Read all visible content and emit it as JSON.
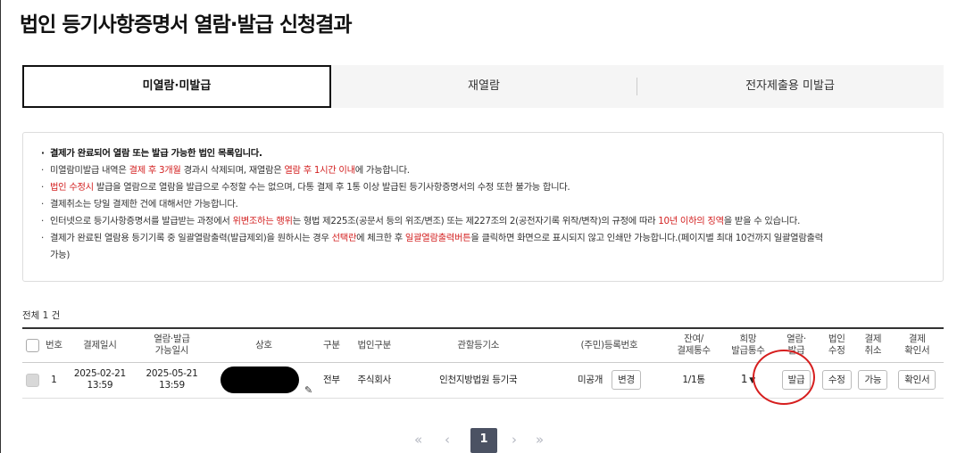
{
  "page_title": "법인 등기사항증명서 열람·발급 신청결과",
  "tabs": [
    {
      "label": "미열람·미발급",
      "active": true
    },
    {
      "label": "재열람",
      "active": false
    },
    {
      "label": "전자제출용 미발급",
      "active": false
    }
  ],
  "notice": {
    "line1": "결제가 완료되어 열람 또는 발급 가능한 법인 목록입니다.",
    "line2": {
      "a": "미열람미발급 내역은 ",
      "b": "결제 후 3개월",
      "c": " 경과시 삭제되며, 재열람은 ",
      "d": "열람 후 1시간 이내",
      "e": "에 가능합니다."
    },
    "line3": {
      "a": "법인 수정시",
      "b": " 발급을 열람으로 열람을 발급으로 수정할 수는 없으며, 다통 결제 후 1통 이상 발급된 등기사항증명서의 수정 또한 불가능 합니다."
    },
    "line4": "결제취소는 당일 결제한 건에 대해서만 가능합니다.",
    "line5": {
      "a": "인터넷으로 등기사항증명서를 발급받는 과정에서 ",
      "b": "위변조하는 행위",
      "c": "는 형법 제225조(공문서 등의 위조/변조) 또는 제227조의 2(공전자기록 위작/변작)의 규정에 따라 ",
      "d": "10년 이하의 징역",
      "e": "을 받을 수 있습니다."
    },
    "line6": {
      "a": "결제가 완료된 열람용 등기기록 중 일괄열람출력(발급제외)을 원하시는 경우 ",
      "b": "선택란",
      "c": "에 체크한 후 ",
      "d": "일괄열람출력버튼",
      "e": "을 클릭하면 화면으로 표시되지 않고 인쇄만 가능합니다.(페이지별 최대 10건까지 일괄열람출력",
      "f": "가능)"
    }
  },
  "count_label": "전체 1 건",
  "table": {
    "headers": {
      "no": "번호",
      "paid_date": "결제일시",
      "avail_date_1": "열람·발급",
      "avail_date_2": "가능일시",
      "company": "상호",
      "type": "구분",
      "corp_type": "법인구분",
      "registry": "관할등기소",
      "reg_no": "(주민)등록번호",
      "remain_1": "잔여/",
      "remain_2": "결제통수",
      "hope_1": "희망",
      "hope_2": "발급통수",
      "issue_1": "열람·",
      "issue_2": "발급",
      "edit_1": "법인",
      "edit_2": "수정",
      "cancel_1": "결제",
      "cancel_2": "취소",
      "receipt_1": "결제",
      "receipt_2": "확인서"
    },
    "rows": [
      {
        "no": "1",
        "paid_date": "2025-02-21",
        "paid_time": "13:59",
        "avail_date": "2025-05-21",
        "avail_time": "13:59",
        "type": "전부",
        "corp_type": "주식회사",
        "registry": "인천지방법원 등기국",
        "reg_no": "미공개",
        "change_btn": "변경",
        "remain": "1/1통",
        "hope_count": "1",
        "issue_btn": "발급",
        "edit_btn": "수정",
        "cancel_btn": "가능",
        "receipt_btn": "확인서"
      }
    ]
  },
  "pagination": {
    "first": "«",
    "prev": "‹",
    "current": "1",
    "next": "›",
    "last": "»"
  },
  "colors": {
    "highlight_red": "#d32222",
    "pager_active": "#4b5263"
  }
}
